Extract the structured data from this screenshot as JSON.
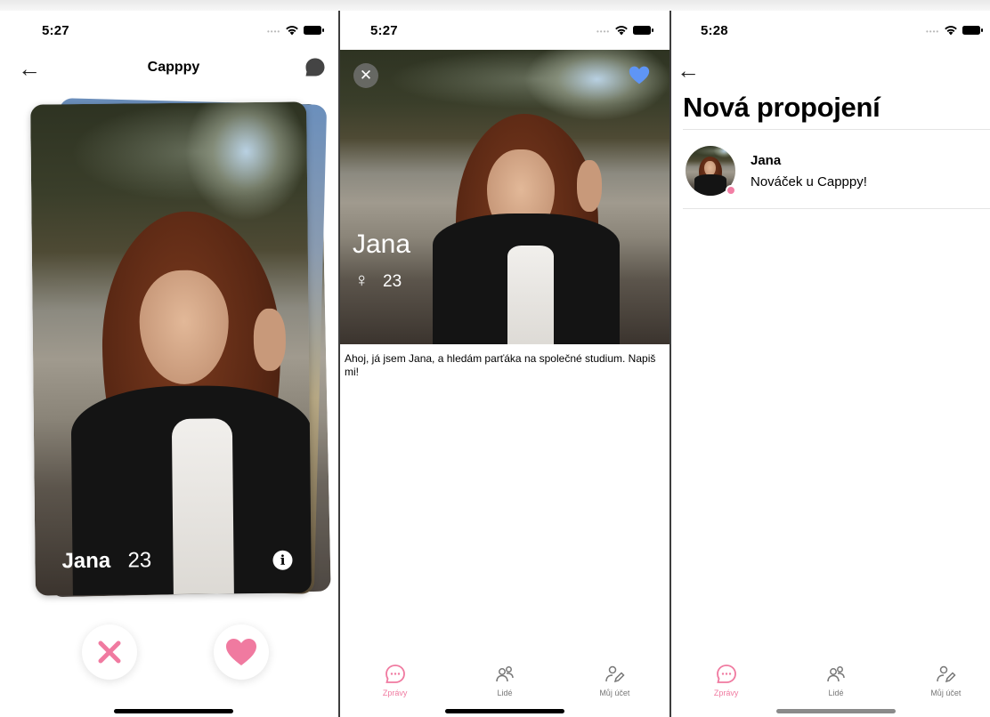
{
  "screens": [
    {
      "status": {
        "time": "5:27"
      },
      "nav": {
        "title": "Capppy"
      },
      "card": {
        "name": "Jana",
        "age": "23"
      },
      "actions": {
        "dislike_icon": "x-icon",
        "like_icon": "heart-icon"
      }
    },
    {
      "status": {
        "time": "5:27"
      },
      "profile": {
        "name": "Jana",
        "gender_symbol": "♀",
        "age": "23",
        "bio": "Ahoj, já jsem Jana, a hledám parťáka na společné studium. Napiš mi!"
      }
    },
    {
      "status": {
        "time": "5:28"
      },
      "title": "Nová propojení",
      "conversations": [
        {
          "name": "Jana",
          "message": "Nováček u Capppy!"
        }
      ]
    }
  ],
  "tabbar": {
    "items": [
      {
        "label": "Zprávy",
        "icon": "chat-bubble-icon",
        "active": true
      },
      {
        "label": "Lidé",
        "icon": "people-icon",
        "active": false
      },
      {
        "label": "Můj účet",
        "icon": "user-edit-icon",
        "active": false
      }
    ]
  },
  "colors": {
    "accent_pink": "#f07aa0",
    "like_blue": "#5f95f5",
    "tab_inactive": "#777777"
  }
}
